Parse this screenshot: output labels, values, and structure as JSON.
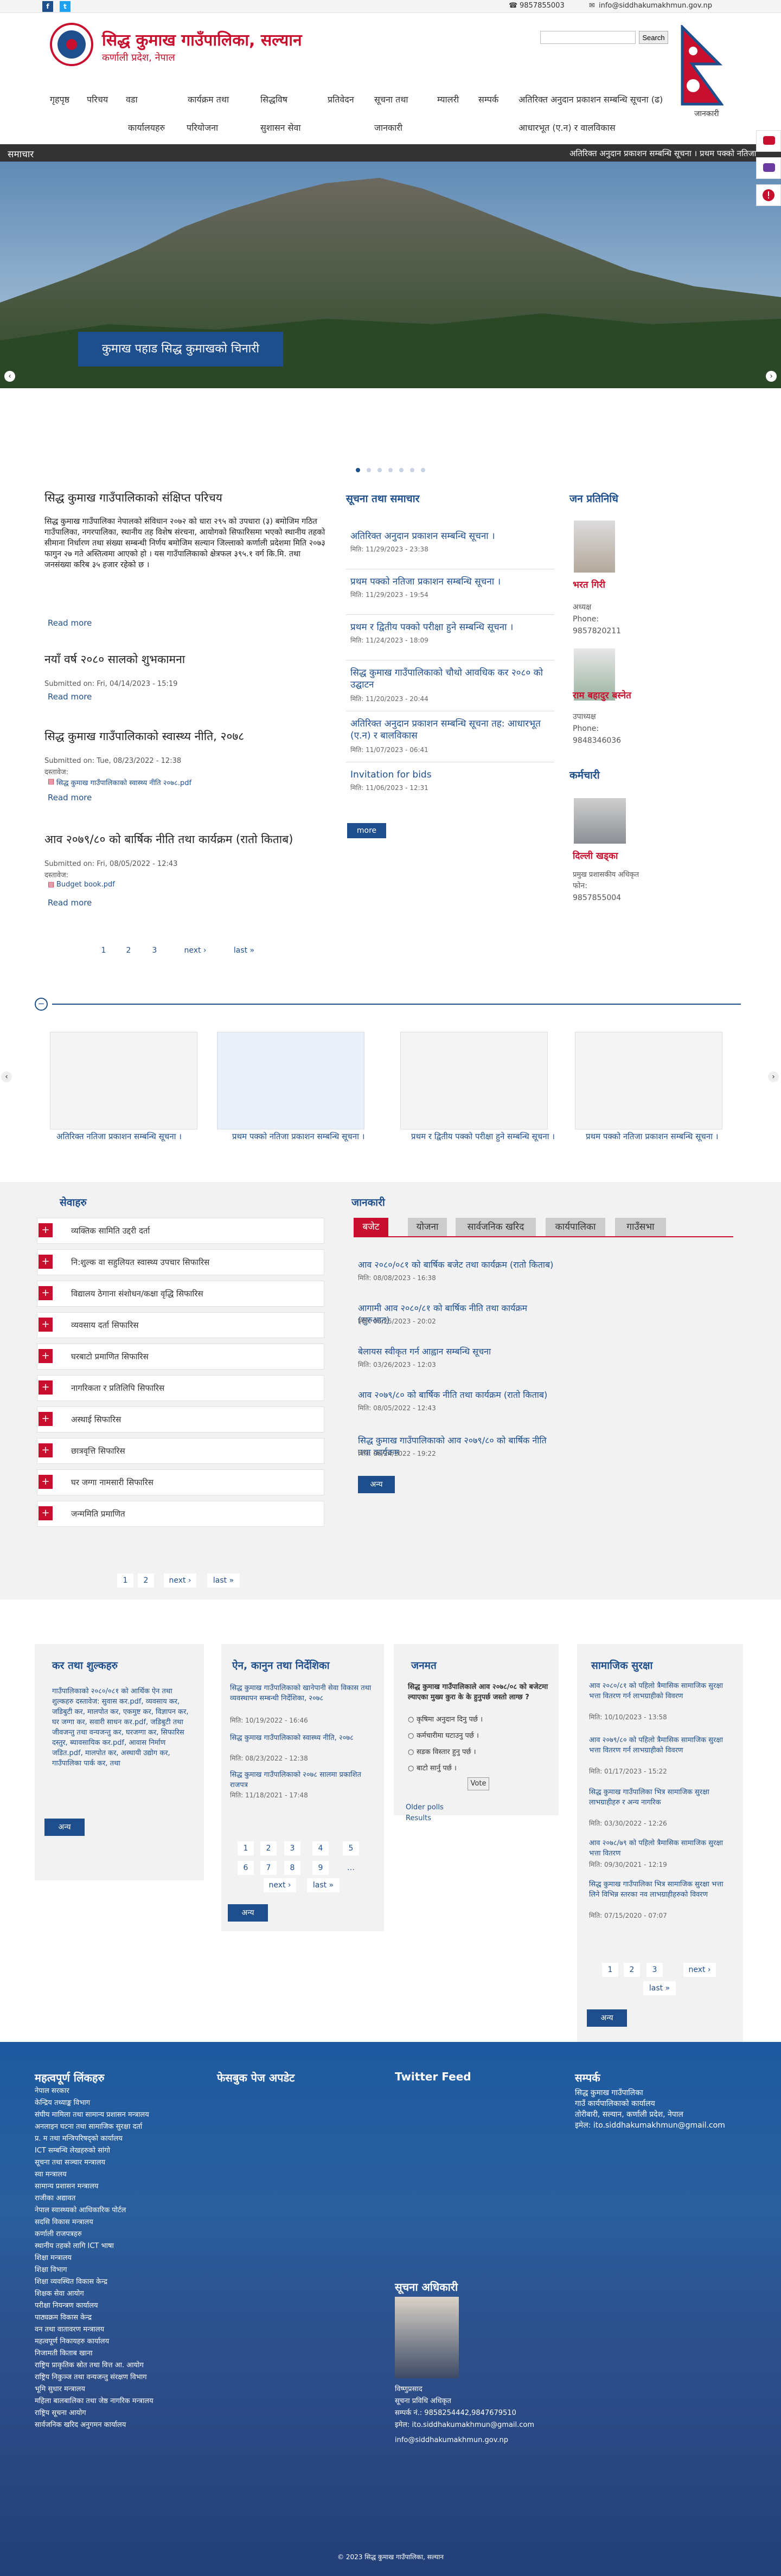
{
  "topbar": {
    "phone": "9857855003",
    "email": "info@siddhakumakhmun.gov.np"
  },
  "header": {
    "title": "सिद्ध कुमाख गाउँपालिका, सल्यान",
    "subtitle": "कर्णाली प्रदेश, नेपाल",
    "search_placeholder": "",
    "search_button": "Search",
    "flag_caption": "जानकारी"
  },
  "nav": {
    "row1": [
      "गृहपृष्ठ",
      "परिचय",
      "वडा",
      "कार्यक्रम तथा",
      "सिद्धविष",
      "प्रतिवेदन",
      "सूचना तथा",
      "म्यालरी",
      "सम्पर्क",
      "अतिरिक्त अनुदान प्रकाशन सम्बन्धि सूचना (ढ)"
    ],
    "row2": [
      "कार्यालयहरु",
      "परियोजना",
      "सुशासन सेवा",
      "जानकारी",
      "आधारभूत (ए.न) र वालविकास"
    ]
  },
  "newsbar": {
    "label": "समाचार",
    "ticker": "अतिरिक्त अनुदान प्रकाशन सम्बन्धि सूचना ।     प्रथम पक्को नतिजा"
  },
  "hero": {
    "caption": "कुमाख पहाड सिद्ध कुमाखको चिनारी"
  },
  "intro": {
    "title": "सिद्ध कुमाख गाउँपालिकाको संक्षिप्त परिचय",
    "body": "सिद्ध कुमाख गाउँपालिका नेपालको संविधान २०७२ को धारा २९५ को उपधारा (३) बमोजिम गठित गाउँपालिका, नगरपालिका, स्थानीय तह विशेष संरचना, आयोगको सिफारिसमा भएको स्थानीय तहको सीमाना निर्धारण तथा संख्या सम्बन्धी निर्णय बमोजिम सल्यान जिल्लाको कर्णाली प्रदेशमा मिति २०७३ फागुन २७ गते अस्तित्वमा आएको हो । यस गाउँपालिकाको क्षेत्रफल ३९५.१ वर्ग कि.मि. तथा जनसंख्या करिब ३५ हजार रहेको छ ।",
    "read_more": "Read more"
  },
  "articles": [
    {
      "title": "नयाँ वर्ष २०८० सालको शुभकामना",
      "submitted": "Submitted on: Fri, 04/14/2023 - 15:19",
      "attach_label": "",
      "attach": "",
      "read_more": "Read more"
    },
    {
      "title": "सिद्ध कुमाख गाउँपालिकाको स्वास्थ्य नीति, २०७८",
      "submitted": "Submitted on: Tue, 08/23/2022 - 12:38",
      "attach_label": "दस्तावेज:",
      "attach": "सिद्ध कुमाख गाउँपालिकाको स्वास्थ्य नीति २०७८.pdf",
      "read_more": "Read more"
    },
    {
      "title": "आव २०७९/८० को बार्षिक नीति तथा कार्यक्रम (रातो किताब)",
      "submitted": "Submitted on: Fri, 08/05/2022 - 12:43",
      "attach_label": "दस्तावेज:",
      "attach": "Budget book.pdf",
      "read_more": "Read more"
    }
  ],
  "pager1": [
    "1",
    "2",
    "3",
    "next ›",
    "last »"
  ],
  "notices": {
    "title": "सूचना तथा समाचार",
    "items": [
      {
        "title": "अतिरिक्त अनुदान प्रकाशन सम्बन्धि सूचना ।",
        "date": "मिति: 11/29/2023 - 23:38"
      },
      {
        "title": "प्रथम पक्को नतिजा प्रकाशन सम्बन्धि सूचना ।",
        "date": "मिति: 11/29/2023 - 19:54"
      },
      {
        "title": "प्रथम र द्वितीय पक्को परीक्षा हुने सम्बन्धि सूचना ।",
        "date": "मिति: 11/24/2023 - 18:09"
      },
      {
        "title": "सिद्ध कुमाख गाउँपालिकाको चौथो आवधिक कर २०८० को उद्घाटन",
        "date": "मिति: 11/20/2023 - 20:44"
      },
      {
        "title": "अतिरिक्त अनुदान प्रकाशन सम्बन्धि सूचना तह: आधारभूत (ए.न) र बालविकास",
        "date": "मिति: 11/07/2023 - 06:41"
      },
      {
        "title": "Invitation for bids",
        "date": "मिति: 11/06/2023 - 12:31"
      }
    ],
    "more": "more"
  },
  "reps": {
    "title": "जन प्रतिनिधि",
    "items": [
      {
        "name": "भरत गिरी",
        "role": "अध्यक्ष",
        "phone_label": "Phone:",
        "phone": "9857820211"
      },
      {
        "name": "राम बहादुर बस्नेत",
        "role": "उपाध्यक्ष",
        "phone_label": "Phone:",
        "phone": "9848346036"
      }
    ],
    "staff_title": "कर्मचारी",
    "staff": {
      "name": "दिल्ली खड्का",
      "role": "प्रमुख प्रशासकीय अधिकृत",
      "phone_label": "फोन:",
      "phone": "9857855004"
    }
  },
  "gallery": [
    {
      "caption": "अतिरिक्त नतिजा प्रकाशन सम्बन्धि सूचना ।"
    },
    {
      "caption": "प्रथम पक्को नतिजा प्रकाशन सम्बन्धि सूचना ।"
    },
    {
      "caption": "प्रथम र द्वितीय पक्को परीक्षा हुने सम्बन्धि सूचना ।"
    },
    {
      "caption": "प्रथम पक्को नतिजा प्रकाशन सम्बन्धि सूचना ।"
    }
  ],
  "services": {
    "title": "सेवाहरु",
    "items": [
      "व्यक्तिक सामिति उद्दरी दर्ता",
      "नि:शुल्क वा सहुलियत स्वास्थ्य उपचार सिफारिस",
      "विद्यालय ठेगाना संशोधन/कक्षा वृद्धि सिफारिस",
      "व्यवसाय दर्ता सिफारिस",
      "घरबाटो प्रमाणित सिफारिस",
      "नागरिकता र प्रतिलिपि सिफारिस",
      "अस्थाई सिफारिस",
      "छात्रवृत्ति सिफारिस",
      "घर जग्गा नामसारी सिफारिस",
      "जन्ममिति प्रमाणित"
    ],
    "pager": [
      "1",
      "2",
      "next ›",
      "last »"
    ]
  },
  "janakari": {
    "title": "जानकारी",
    "tabs": [
      "बजेट",
      "योजना",
      "सार्वजनिक खरिद",
      "कार्यपालिका",
      "गाउँसभा"
    ],
    "items": [
      {
        "title": "आव २०८०/०८१ को बार्षिक बजेट तथा कार्यक्रम (रातो किताब)",
        "date": "मिति: 08/08/2023 - 16:38"
      },
      {
        "title": "आगामी आव २०८०/८१ को बार्षिक नीति तथा कार्यक्रम (सुरुआत)",
        "date": "मिति: 06/25/2023 - 20:02"
      },
      {
        "title": "बेलायस स्वीकृत गर्न आह्वान सम्बन्धि सूचना",
        "date": "मिति: 03/26/2023 - 12:03"
      },
      {
        "title": "आव २०७९/८० को बार्षिक नीति तथा कार्यक्रम (रातो किताब)",
        "date": "मिति: 08/05/2022 - 12:43"
      },
      {
        "title": "सिद्ध कुमाख गाउँपालिकाको आव २०७९/८० को बार्षिक नीति तथा कार्यक्रम",
        "date": "मिति: 06/24/2022 - 19:22"
      }
    ],
    "more": "अन्य"
  },
  "widgets": {
    "kar": {
      "title": "कर तथा शुल्कहरु",
      "text": "गाउँपालिकाको २०८०/०८१ को आर्थिक ऐन तथा शुल्कहरु दस्तावेज: सुवास कर.pdf, व्यवसाय कर, जडिबुटी कर, मालपोत कर, एकमुष्ट कर, विज्ञापन कर, घर जग्गा कर, सवारी साधन कर.pdf, जडिबुटी तथा जीवजन्तु तथा वन्यजन्तु कर, घरजग्गा कर, सिफारिस दस्तुर, ब्यावसायिक कर.pdf, आवास निर्माण जडित.pdf, मालपोत कर, अस्थायी उद्योग कर, गाउँपालिका पार्क कर, तथा",
      "more": "अन्य"
    },
    "ain": {
      "title": "ऐन, कानुन तथा निर्देशिका",
      "items": [
        {
          "title": "सिद्ध कुमाख गाउँपालिकाको खानेपानी सेवा विकास तथा व्यवस्थापन सम्बन्धी निर्देशिका, २०७८",
          "date": "मिति: 10/19/2022 - 16:46"
        },
        {
          "title": "सिद्ध कुमाख गाउँपालिकाको स्वास्थ्य नीति, २०७८",
          "date": "मिति: 08/23/2022 - 12:38"
        },
        {
          "title": "सिद्ध कुमाख गाउँपालिकाको २०७८ सालमा प्रकाशित राजपत्र",
          "date": "मिति: 11/18/2021 - 17:48"
        }
      ],
      "pager": [
        "1",
        "2",
        "3",
        "4",
        "5",
        "6",
        "7",
        "8",
        "9",
        "…",
        "next ›",
        "last »"
      ],
      "more": "अन्य"
    },
    "poll": {
      "title": "जनमत",
      "question": "सिद्ध कुमाख गाउँपालिकाले आव २०७८/०८ को बजेटमा ल्याएका मुख्य कुरा के के हुनुपर्छ जस्तो लाग्छ ?",
      "options": [
        "कृषिमा अनुदान दिनु पर्छ ।",
        "कर्मचारीमा घटाउनु पर्छ ।",
        "सडक विस्तार हुनु पर्छ ।",
        "बाटो सार्नु पर्छ ।"
      ],
      "vote": "Vote",
      "older": "Older polls",
      "results": "Results"
    },
    "suraksha": {
      "title": "सामाजिक सुरक्षा",
      "items": [
        {
          "title": "आव २०८०/८१ को पहिलो त्रैमासिक सामाजिक सुरक्षा भत्ता वितरण गर्न लाभग्राहीको विवरण",
          "date": "मिति: 10/10/2023 - 13:58"
        },
        {
          "title": "आव २०७९/८० को पहिलो त्रैमासिक सामाजिक सुरक्षा भत्ता वितरण गर्न लाभग्राहीको विवरण",
          "date": "मिति: 01/17/2023 - 15:22"
        },
        {
          "title": "सिद्ध कुमाख गाउँपालिका भित्र सामाजिक सुरक्षा लाभग्राहीहरु र अन्य नागरिक",
          "date": "मिति: 03/30/2022 - 12:26"
        },
        {
          "title": "आव २०७८/७९ को पहिलो त्रैमासिक सामाजिक सुरक्षा भत्ता वितरण",
          "date": "मिति: 09/30/2021 - 12:19"
        },
        {
          "title": "सिद्ध कुमाख गाउँपालिका भित्र सामाजिक सुरक्षा भत्ता लिने विभिन्न स्तरका नव लाभग्राहीहरुको विवरण",
          "date": "मिति: 07/15/2020 - 07:07"
        }
      ],
      "pager": [
        "1",
        "2",
        "3",
        "next ›",
        "last »"
      ],
      "more": "अन्य"
    }
  },
  "footer": {
    "links_title": "महत्वपूर्ण लिंकहरु",
    "links": [
      "नेपाल सरकार",
      "केन्द्रिय तथ्याङ्क विभाग",
      "संघीय मामिला तथा सामान्य प्रशासन मन्त्रालय",
      "अनलाइन घटना तथा सामाजिक सुरक्षा दर्ता",
      "प्र. म तथा मन्त्रिपरिषद्को कार्यालय",
      "ICT सम्बन्धि लेखहरुको सांगो",
      "सूचना तथा सञ्चार मन्त्रालय",
      "स्वा मन्त्रालय",
      "सामान्य प्रशासन मन्त्रालय",
      "राजीका अद्यावत",
      "नेपाल स्वास्थ्यको आधिकारिक पोर्टल",
      "सदसि विकास मन्त्रालय",
      "कर्णाली राजपत्रहरु",
      "स्थानीय तहको लागि ICT भाषा",
      "शिक्षा मन्त्रालय",
      "शिक्षा विभाग",
      "शिक्षा व्यवस्थित विकास केन्द्र",
      "शिक्षक सेवा आयोग",
      "परीक्षा नियन्त्रण कार्यालय",
      "पाठ्यक्रम विकास केन्द्र",
      "वन तथा वातावरण मन्त्रालय",
      "महत्वपूर्ण निकायहरु कार्यालय",
      "निजामती किताब खाना",
      "राष्ट्रिय प्राकृतिक स्रोत तथा वित्त आ. आयोग",
      "राष्ट्रिय निकुञ्ज तथा वन्यजन्तु संरक्षण विभाग",
      "भूमि सुधार मन्त्रालय",
      "महिला बालबालिका तथा जेष्ठ नागरिक मन्त्रालय",
      "राष्ट्रिय सूचना आयोग",
      "सार्वजनिक खरिद अनुगमन कार्यालय"
    ],
    "facebook_title": "फेसबुक पेज अपडेट",
    "twitter_title": "Twitter Feed",
    "contact_title": "सम्पर्क",
    "contact": [
      "सिद्ध कुमाख गाउँपालिका",
      "गाउँ कार्यपालिकाको कार्यालय",
      "तोरीबारी, सल्यान, कर्णाली प्रदेश, नेपाल",
      "इमेल: ito.siddhakumakhmun@gmail.com"
    ],
    "officer_title": "सूचना अधिकारी",
    "officer": [
      "विष्णुप्रसाद",
      "सूचना प्रविधि अधिकृत",
      "सम्पर्क नं.: 9858254442,9847679510",
      "इमेल: ito.siddhakumakhmun@gmail.com",
      "info@siddhakumakhmun.gov.np"
    ],
    "copyright": "© 2023 सिद्ध कुमाख गाउँपालिका, सल्यान"
  }
}
